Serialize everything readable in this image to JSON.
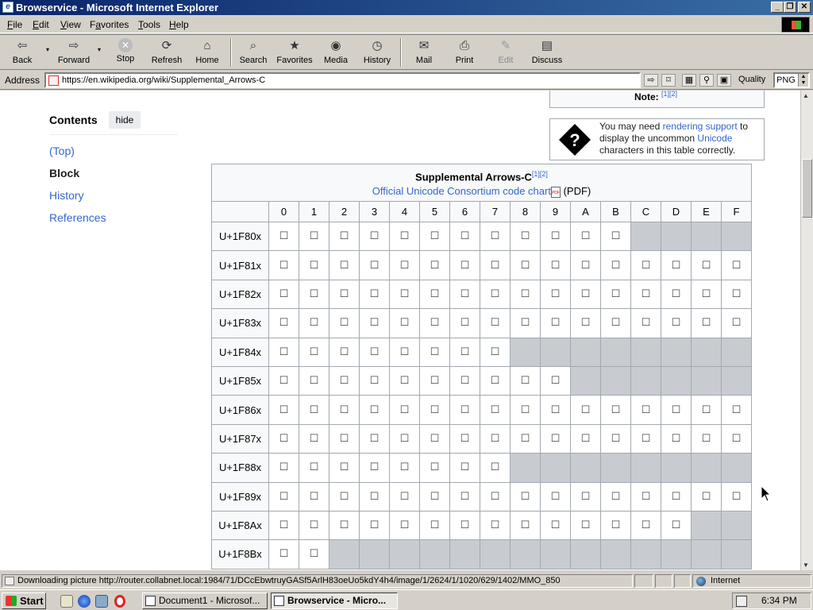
{
  "window": {
    "title": "Browservice - Microsoft Internet Explorer",
    "buttons": [
      "_",
      "❐",
      "✕"
    ]
  },
  "menu": [
    {
      "label": "File",
      "key": "F",
      "rest": "ile"
    },
    {
      "label": "Edit",
      "key": "E",
      "rest": "dit"
    },
    {
      "label": "View",
      "key": "V",
      "rest": "iew"
    },
    {
      "label": "Favorites",
      "key": "a",
      "pre": "F",
      "rest": "vorites"
    },
    {
      "label": "Tools",
      "key": "T",
      "rest": "ools"
    },
    {
      "label": "Help",
      "key": "H",
      "rest": "elp"
    }
  ],
  "toolbar": {
    "back": "Back",
    "forward": "Forward",
    "stop": "Stop",
    "refresh": "Refresh",
    "home": "Home",
    "search": "Search",
    "favorites": "Favorites",
    "media": "Media",
    "history": "History",
    "mail": "Mail",
    "print": "Print",
    "edit": "Edit",
    "discuss": "Discuss"
  },
  "address": {
    "label": "Address",
    "url": "https://en.wikipedia.org/wiki/Supplemental_Arrows-C",
    "quality_label": "Quality",
    "quality_value": "PNG"
  },
  "toc": {
    "heading": "Contents",
    "hide": "hide",
    "items": [
      "(Top)",
      "Block",
      "History",
      "References"
    ],
    "current": "Block"
  },
  "note": {
    "label": "Note",
    "refs": "[1][2]"
  },
  "ambox": {
    "pre": "You may need ",
    "link1": "rendering support",
    "mid": " to display the uncommon ",
    "link2": "Unicode",
    "post": " characters in this table correctly."
  },
  "block_table": {
    "title": "Supplemental Arrows-C",
    "title_refs": "[1][2]",
    "chart_link": "Official Unicode Consortium code chart",
    "pdf_note": "(PDF)",
    "columns": [
      "0",
      "1",
      "2",
      "3",
      "4",
      "5",
      "6",
      "7",
      "8",
      "9",
      "A",
      "B",
      "C",
      "D",
      "E",
      "F"
    ],
    "glyph": "☐",
    "rows": [
      {
        "label": "U+1F80x",
        "assigned": 12
      },
      {
        "label": "U+1F81x",
        "assigned": 16
      },
      {
        "label": "U+1F82x",
        "assigned": 16
      },
      {
        "label": "U+1F83x",
        "assigned": 16
      },
      {
        "label": "U+1F84x",
        "assigned": 8
      },
      {
        "label": "U+1F85x",
        "assigned": 10
      },
      {
        "label": "U+1F86x",
        "assigned": 16
      },
      {
        "label": "U+1F87x",
        "assigned": 16
      },
      {
        "label": "U+1F88x",
        "assigned": 8
      },
      {
        "label": "U+1F89x",
        "assigned": 16
      },
      {
        "label": "U+1F8Ax",
        "assigned": 14
      },
      {
        "label": "U+1F8Bx",
        "assigned": 2
      }
    ]
  },
  "status": {
    "text": "Downloading picture http://router.collabnet.local:1984/71/DCcEbwtruyGASf5ArlH83oeUo5kdY4h4/image/1/2624/1/1020/629/1402/MMO_850",
    "zone": "Internet"
  },
  "taskbar": {
    "start": "Start",
    "tasks": [
      "Document1 - Microsof...",
      "Browservice - Micro..."
    ],
    "active_task": 1,
    "clock": "6:34 PM"
  },
  "colors": {
    "titlebar": "#0a246a",
    "link": "#3366cc",
    "empty_cell": "#c8ccd1",
    "header_bg": "#f8f9fa"
  },
  "icons": {
    "back": "arrow-left-icon",
    "forward": "arrow-right-icon",
    "stop": "stop-icon",
    "refresh": "refresh-icon",
    "home": "home-icon",
    "search": "search-icon",
    "favorites": "star-icon",
    "media": "media-icon",
    "history": "history-icon",
    "mail": "mail-icon",
    "print": "printer-icon",
    "edit": "edit-icon",
    "discuss": "discuss-icon"
  }
}
